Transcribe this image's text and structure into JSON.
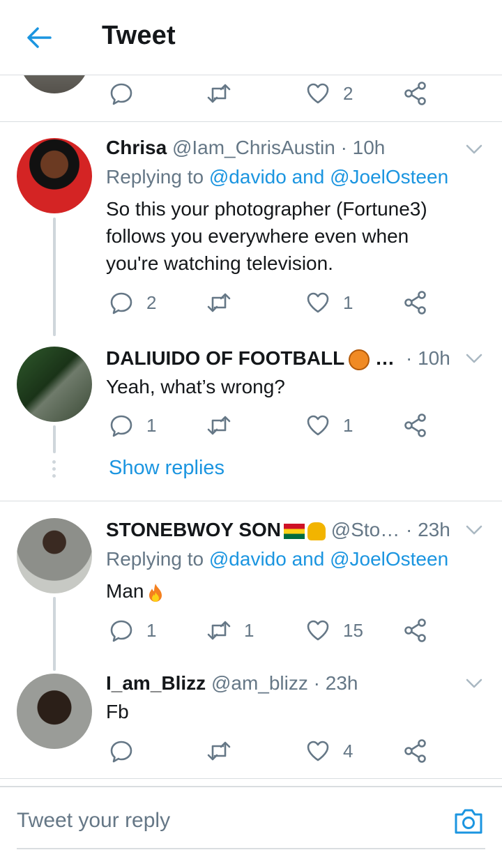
{
  "header": {
    "title": "Tweet",
    "back_icon": "arrow-left-icon"
  },
  "top_tweet": {
    "reply_count": "",
    "retweet_count": "",
    "like_count": "2"
  },
  "tweets": [
    {
      "display_name": "Chrisa",
      "handle": "@Iam_ChrisAustin",
      "time": "· 10h",
      "replying_prefix": "Replying to",
      "replying_to": "@davido and @JoelOsteen",
      "text_lines": [
        "So this your photographer (Fortune3)",
        "follows you everywhere even when",
        "you're watching television."
      ],
      "reply_count": "2",
      "retweet_count": "",
      "like_count": "1"
    },
    {
      "display_name": "DALIUIDO OF FOOTBALL",
      "name_suffix": "…",
      "time": "· 10h",
      "text": "Yeah, what’s wrong?",
      "reply_count": "1",
      "retweet_count": "",
      "like_count": "1"
    },
    {
      "display_name": "STONEBWOY SON",
      "handle": "@Sto…",
      "time": "· 23h",
      "replying_prefix": "Replying to",
      "replying_to": "@davido and @JoelOsteen",
      "text": "Man",
      "reply_count": "1",
      "retweet_count": "1",
      "like_count": "15"
    },
    {
      "display_name": "I_am_Blizz",
      "handle": "@am_blizz",
      "time": "· 23h",
      "text": "Fb",
      "reply_count": "",
      "retweet_count": "",
      "like_count": "4"
    }
  ],
  "show_replies": "Show replies",
  "reply_box": {
    "placeholder": "Tweet your reply",
    "camera_icon": "camera-icon"
  },
  "colors": {
    "accent": "#1b95e0",
    "muted": "#657786",
    "divider": "#d9dde0"
  }
}
